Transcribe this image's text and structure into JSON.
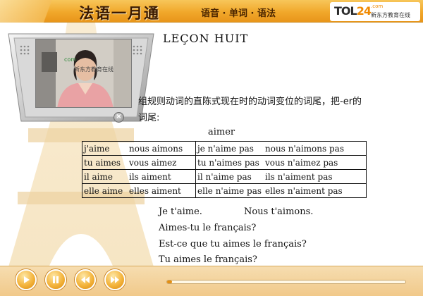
{
  "header": {
    "course_title": "法语一月通",
    "subtitle": "语音 · 单词 · 语法",
    "brand": {
      "logo_text": "TOL",
      "logo_number": "24",
      "domain": ".com",
      "tagline": "新东方教育在线"
    }
  },
  "video": {
    "watermark": "新东方教育在线",
    "watermark_small": "com",
    "close_icon": "close-icon"
  },
  "lesson": {
    "title": "LEÇON HUIT",
    "instruction_line1": "组规则动词的直陈式现在时的动词变位的词尾，把-er的",
    "instruction_line2": "词尾:",
    "verb": "aimer",
    "conjugation": [
      {
        "affirmative": [
          "j'aime",
          "nous aimons"
        ],
        "negative": [
          "je n'aime pas",
          "nous n'aimons pas"
        ]
      },
      {
        "affirmative": [
          "tu aimes",
          "vous aimez"
        ],
        "negative": [
          "tu n'aimes pas",
          "vous n'aimez pas"
        ]
      },
      {
        "affirmative": [
          "il aime",
          "ils aiment"
        ],
        "negative": [
          "il n'aime pas",
          "ils n'aiment pas"
        ]
      },
      {
        "affirmative": [
          "elle aime",
          "elles aiment"
        ],
        "negative": [
          "elle n'aime pas",
          "elles n'aiment pas"
        ]
      }
    ],
    "examples": {
      "ex1a": "Je t'aime.",
      "ex1b": "Nous t'aimons.",
      "ex2": "Aimes-tu le français?",
      "ex3": "Est-ce que tu aimes le français?",
      "ex4": "Tu aimes le français?"
    }
  },
  "controls": {
    "play_icon": "play-icon",
    "pause_icon": "pause-icon",
    "rewind_icon": "rewind-icon",
    "forward_icon": "fast-forward-icon",
    "progress_fraction": 0.02
  },
  "colors": {
    "header": "#f1a82b",
    "accent": "#e48f12",
    "text": "#111111"
  }
}
